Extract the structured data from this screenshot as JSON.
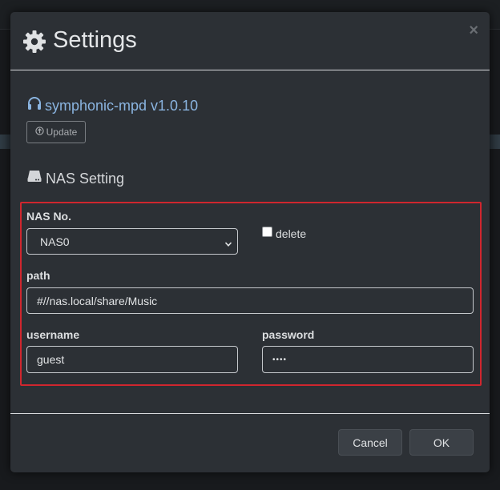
{
  "modal": {
    "title": "Settings",
    "close_label": "×"
  },
  "app": {
    "name": "symphonic-mpd v1.0.10",
    "update_label": "Update"
  },
  "nas_section": {
    "title": "NAS Setting",
    "nas_no_label": "NAS No.",
    "nas_no_value": "NAS0",
    "nas_no_options": [
      "NAS0"
    ],
    "delete_label": "delete",
    "delete_checked": false,
    "path_label": "path",
    "path_value": "#//nas.local/share/Music",
    "username_label": "username",
    "username_value": "guest",
    "password_label": "password",
    "password_value": "••••"
  },
  "footer": {
    "cancel_label": "Cancel",
    "ok_label": "OK"
  },
  "colors": {
    "accent_link": "#8ab4e0",
    "highlight_border": "#d0262e",
    "modal_bg": "#2c3035"
  },
  "icons": {
    "title": "gear-icon",
    "app": "headphones-icon",
    "update": "arrow-circle-up-icon",
    "section": "hard-drive-icon",
    "select": "chevron-down-icon"
  }
}
